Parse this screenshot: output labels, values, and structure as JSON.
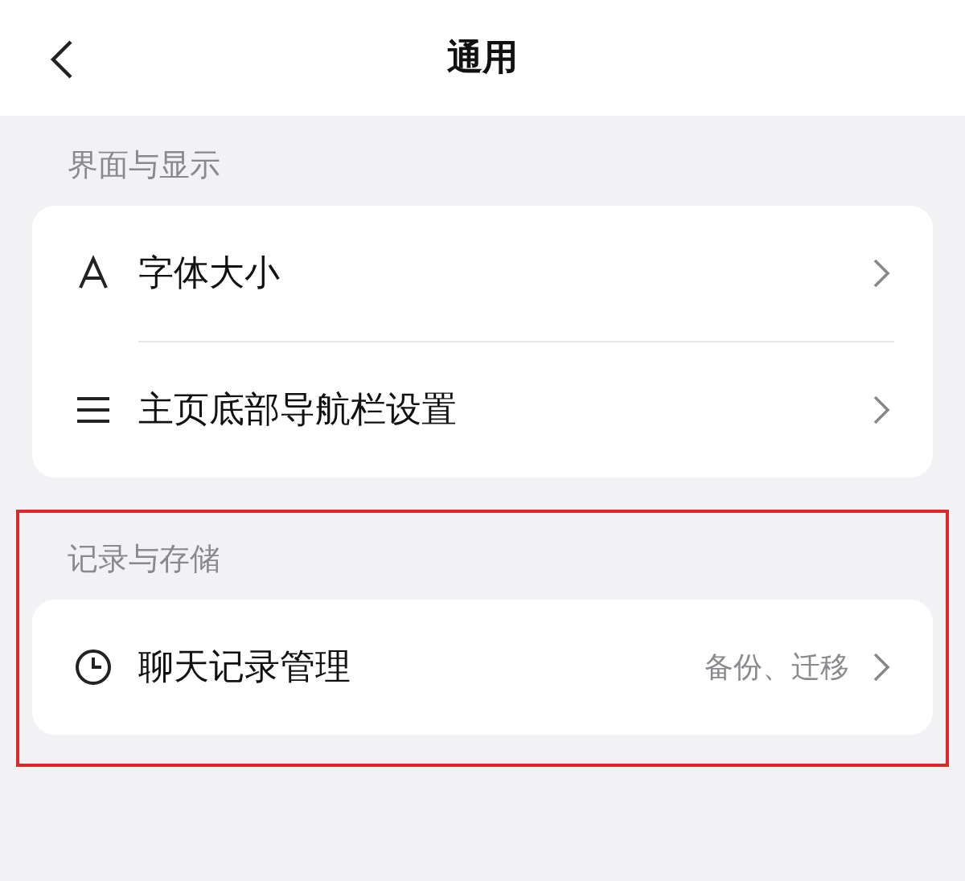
{
  "header": {
    "title": "通用"
  },
  "sections": [
    {
      "title": "界面与显示",
      "highlighted": false,
      "items": [
        {
          "kind": "font",
          "label": "字体大小"
        },
        {
          "kind": "menu",
          "label": "主页底部导航栏设置"
        }
      ]
    },
    {
      "title": "记录与存储",
      "highlighted": true,
      "items": [
        {
          "kind": "clock",
          "label": "聊天记录管理",
          "value": "备份、迁移"
        }
      ]
    }
  ]
}
